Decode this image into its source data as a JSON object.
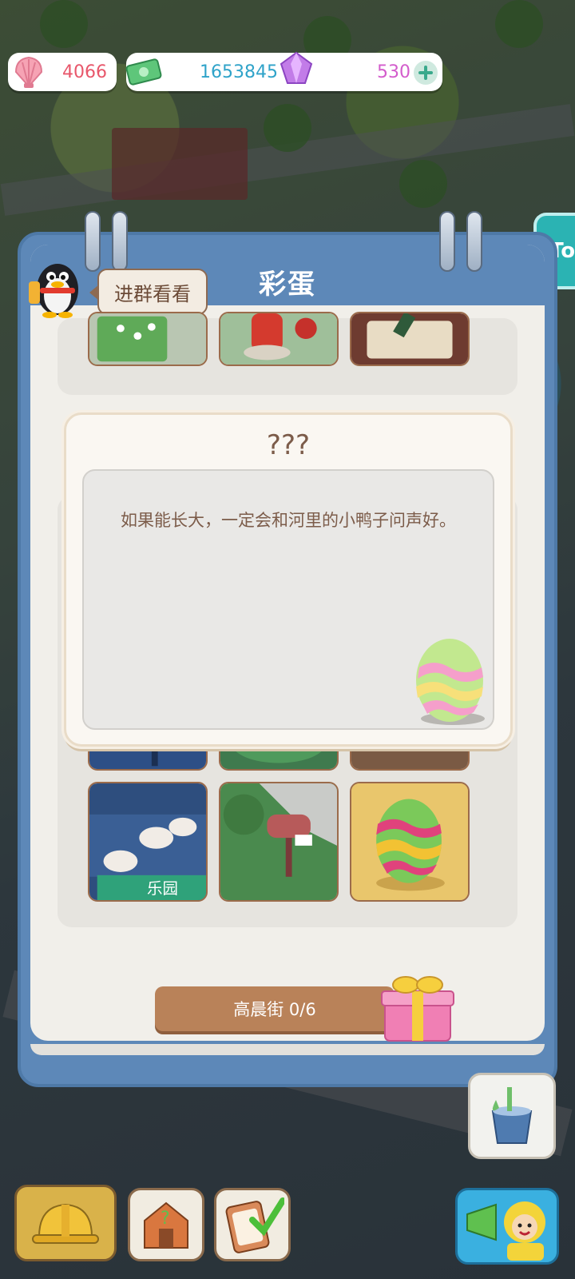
{
  "resources": {
    "shells": "4066",
    "cash": "1653845",
    "gems": "530"
  },
  "side_button": {
    "label": "To"
  },
  "book": {
    "title": "彩蛋",
    "group_bubble": "进群看看",
    "street_progress": "高晨街 0/6"
  },
  "popup": {
    "title": "???",
    "description": "如果能长大，一定会和河里的小鸭子问声好。"
  },
  "cards": [
    {
      "name": "garden-card"
    },
    {
      "name": "postbox-card"
    },
    {
      "name": "statue-card"
    },
    {
      "name": "night-card"
    },
    {
      "name": "lawn-card"
    },
    {
      "name": "balcony-card"
    },
    {
      "name": "cats-roof-card",
      "sign": "乐园"
    },
    {
      "name": "mailbox-card"
    },
    {
      "name": "egg-card"
    }
  ],
  "colors": {
    "book_blue": "#5d88b8",
    "shell_text": "#e8576b",
    "cash_text": "#2fa3c9",
    "gem_text": "#d35ccc",
    "button_brown": "#b98259"
  }
}
